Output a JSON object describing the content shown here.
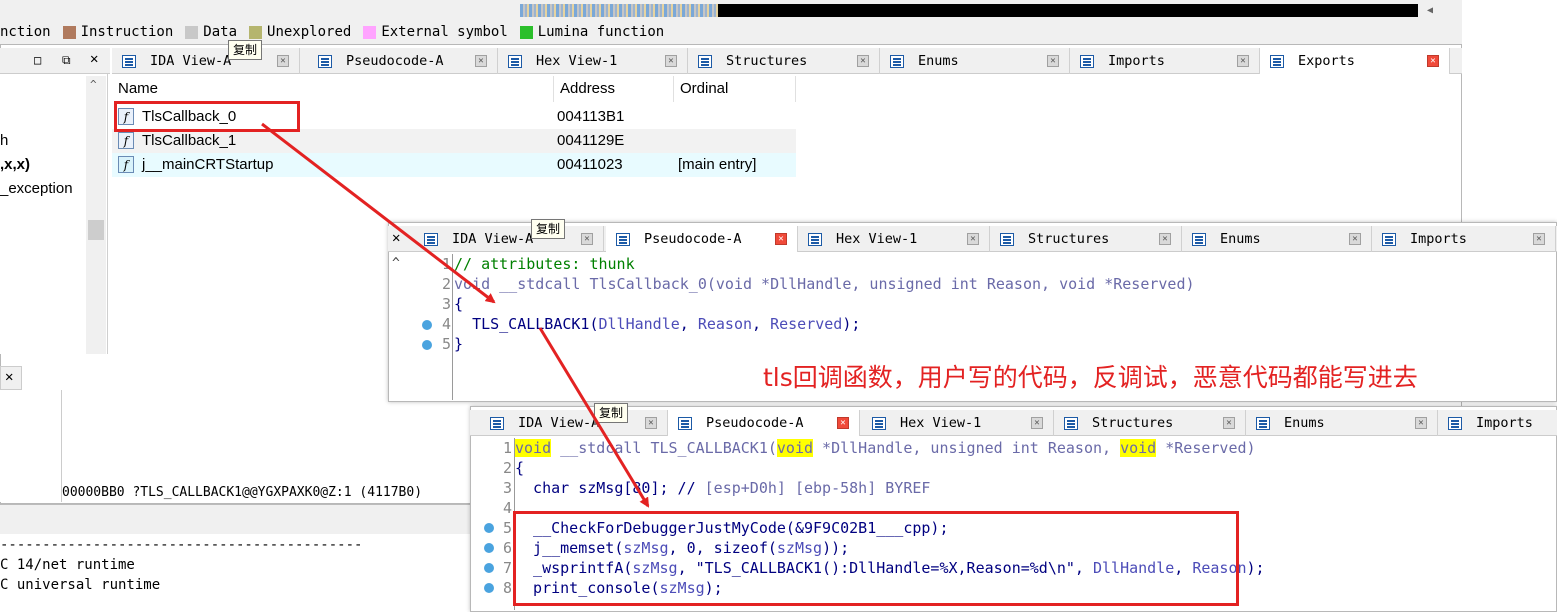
{
  "legend": [
    {
      "label": "nction",
      "color": ""
    },
    {
      "label": "Instruction",
      "color": "#b07a5e"
    },
    {
      "label": "Data",
      "color": "#c8c8c8"
    },
    {
      "label": "Unexplored",
      "color": "#b5b56e"
    },
    {
      "label": "External symbol",
      "color": "#ffa4ff"
    },
    {
      "label": "Lumina function",
      "color": "#2bbf2b"
    }
  ],
  "left_panel": {
    "items": [
      "h",
      ",x,x)",
      "_exception"
    ]
  },
  "tip": "复制",
  "tabs": [
    "IDA View-A",
    "Pseudocode-A",
    "Hex View-1",
    "Structures",
    "Enums",
    "Imports",
    "Exports"
  ],
  "exports": {
    "columns": [
      "Name",
      "Address",
      "Ordinal"
    ],
    "rows": [
      {
        "name": "TlsCallback_0",
        "address": "004113B1",
        "ordinal": ""
      },
      {
        "name": "TlsCallback_1",
        "address": "0041129E",
        "ordinal": ""
      },
      {
        "name": "j__mainCRTStartup",
        "address": "00411023",
        "ordinal": "[main entry]"
      }
    ]
  },
  "status_line": "00000BB0 ?TLS_CALLBACK1@@YGXPAXK0@Z:1 (4117B0)",
  "output_lines": [
    "-------------------------------------------",
    "C 14/net runtime",
    "C universal runtime"
  ],
  "pseudo1": {
    "line_numbers": [
      "1",
      "2",
      "3",
      "4",
      "5"
    ],
    "comment": "// attributes: thunk",
    "sig_void": "void",
    "sig_rest": " __stdcall TlsCallback_0(void *DllHandle, unsigned int Reason, void *Reserved)",
    "open": "{",
    "call_fn": "TLS_CALLBACK1(",
    "call_a1": "DllHandle",
    "call_sep1": ", ",
    "call_a2": "Reason",
    "call_sep2": ", ",
    "call_a3": "Reserved",
    "call_end": ");",
    "close": "}"
  },
  "annotation": "tls回调函数，用户写的代码，反调试，恶意代码都能写进去",
  "pseudo2": {
    "line_numbers": [
      "1",
      "2",
      "3",
      "4",
      "5",
      "6",
      "7",
      "8"
    ],
    "l1_void1": "void",
    "l1_mid1": " __stdcall TLS_CALLBACK1(",
    "l1_void2": "void",
    "l1_mid2": " *DllHandle, unsigned int Reason, ",
    "l1_void3": "void",
    "l1_end": " *Reserved)",
    "l2": "{",
    "l3_decl": "  char szMsg[80]; // ",
    "l3_cmt": "[esp+D0h] [ebp-58h] BYREF",
    "l5": "  __CheckForDebuggerJustMyCode(&9F9C02B1___cpp);",
    "l6_a": "  j__memset(",
    "l6_v1": "szMsg",
    "l6_b": ", 0, sizeof(",
    "l6_v2": "szMsg",
    "l6_c": "));",
    "l7_fn": "  _wsprintfA(",
    "l7_v1": "szMsg",
    "l7_b": ", \"TLS_CALLBACK1():DllHandle=%X,Reason=%d\\n\", ",
    "l7_v2": "DllHandle",
    "l7_c": ", ",
    "l7_v3": "Reason",
    "l7_d": ");",
    "l8_a": "  print_console(",
    "l8_v": "szMsg",
    "l8_b": ");"
  }
}
